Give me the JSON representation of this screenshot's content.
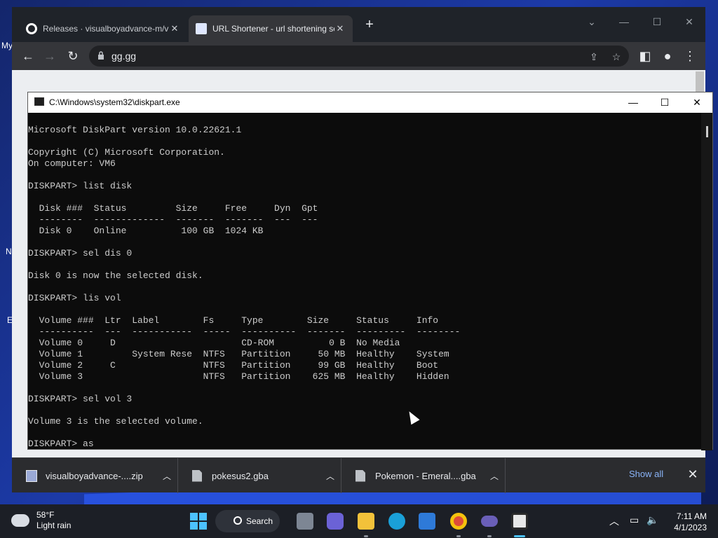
{
  "desktop": {
    "left_labels": [
      "My",
      "N",
      "E"
    ]
  },
  "browser": {
    "tabs": [
      {
        "title": "Releases · visualboyadvance-m/visualboyadvance-m",
        "favicon": "github-icon"
      },
      {
        "title": "URL Shortener - url shortening service",
        "favicon": "link-icon"
      }
    ],
    "address": "gg.gg",
    "window_controls": {
      "dropdown": "⌄",
      "minimize": "—",
      "maximize": "☐",
      "close": "✕"
    }
  },
  "downloads": {
    "items": [
      {
        "name": "visualboyadvance-....zip",
        "icon": "zip-icon"
      },
      {
        "name": "pokesus2.gba",
        "icon": "file-icon"
      },
      {
        "name": "Pokemon - Emeral....gba",
        "icon": "file-icon"
      }
    ],
    "show_all": "Show all"
  },
  "console": {
    "title": "C:\\Windows\\system32\\diskpart.exe",
    "text": "Microsoft DiskPart version 10.0.22621.1\n\nCopyright (C) Microsoft Corporation.\nOn computer: VM6\n\nDISKPART> list disk\n\n  Disk ###  Status         Size     Free     Dyn  Gpt\n  --------  -------------  -------  -------  ---  ---\n  Disk 0    Online          100 GB  1024 KB\n\nDISKPART> sel dis 0\n\nDisk 0 is now the selected disk.\n\nDISKPART> lis vol\n\n  Volume ###  Ltr  Label        Fs     Type        Size     Status     Info\n  ----------  ---  -----------  -----  ----------  -------  ---------  --------\n  Volume 0     D                       CD-ROM          0 B  No Media\n  Volume 1         System Rese  NTFS   Partition     50 MB  Healthy    System\n  Volume 2     C                NTFS   Partition     99 GB  Healthy    Boot\n  Volume 3                      NTFS   Partition    625 MB  Healthy    Hidden\n\nDISKPART> sel vol 3\n\nVolume 3 is the selected volume.\n\nDISKPART> as"
  },
  "taskbar": {
    "weather": {
      "temp": "58°F",
      "condition": "Light rain"
    },
    "search_label": "Search",
    "pinned": [
      "start-icon",
      "task-view-icon",
      "teams-icon",
      "file-explorer-icon",
      "edge-icon",
      "store-icon",
      "chrome-icon",
      "gamepad-icon",
      "terminal-icon"
    ],
    "clock": {
      "time": "7:11 AM",
      "date": "4/1/2023"
    }
  },
  "colors": {
    "accent": "#4cc2ff",
    "console_bg": "#0c0c0c",
    "console_text": "#cccccc",
    "link": "#8ab4f8"
  }
}
